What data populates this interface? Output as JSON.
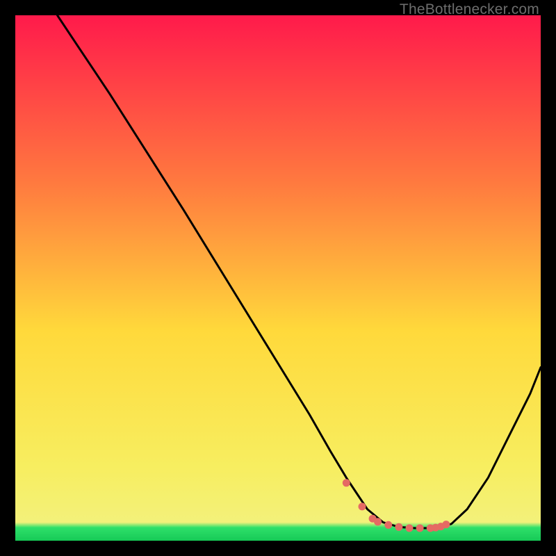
{
  "watermark": "TheBottlenecker.com",
  "colors": {
    "curve": "#000000",
    "markers": "#e56a63",
    "gradient_top": "#ff1a4b",
    "gradient_mid_upper": "#ff7a3f",
    "gradient_mid": "#ffd93b",
    "gradient_mid_lower": "#f7ee60",
    "gradient_bottom": "#2fe06a"
  },
  "chart_data": {
    "type": "line",
    "title": "",
    "xlabel": "",
    "ylabel": "",
    "xlim": [
      0,
      100
    ],
    "ylim": [
      0,
      100
    ],
    "series": [
      {
        "name": "curve",
        "x": [
          8,
          12,
          18,
          25,
          32,
          40,
          48,
          56,
          60,
          63,
          65,
          67,
          70,
          73,
          76,
          79,
          81,
          83,
          86,
          90,
          94,
          98,
          100
        ],
        "y": [
          100,
          94,
          85,
          74,
          63,
          50,
          37,
          24,
          17,
          12,
          9,
          6,
          3.5,
          2.6,
          2.4,
          2.4,
          2.6,
          3.2,
          6,
          12,
          20,
          28,
          33
        ]
      }
    ],
    "markers": {
      "name": "highlight-points",
      "x": [
        63,
        66,
        68,
        69,
        71,
        73,
        75,
        77,
        79,
        80,
        81,
        82
      ],
      "y": [
        11,
        6.5,
        4.2,
        3.6,
        3.0,
        2.6,
        2.4,
        2.4,
        2.4,
        2.5,
        2.7,
        3.1
      ]
    }
  }
}
